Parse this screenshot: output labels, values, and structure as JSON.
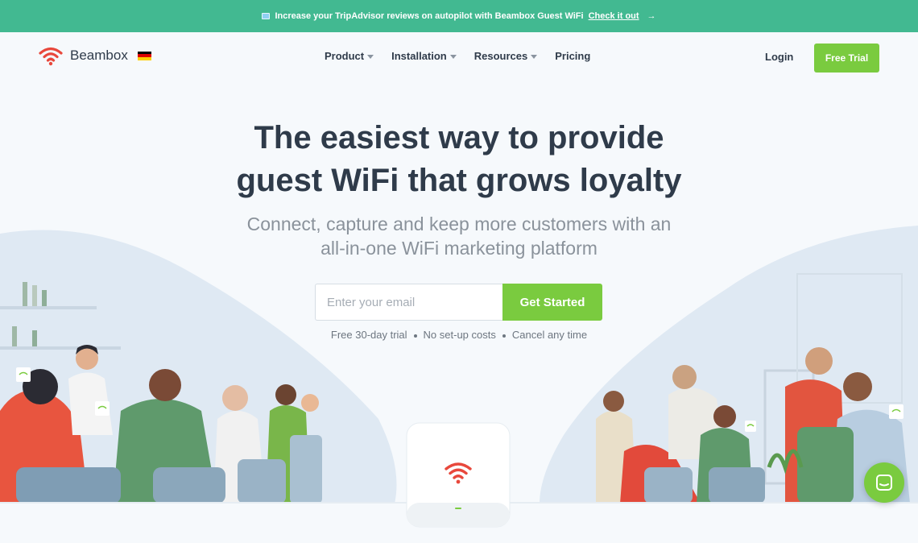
{
  "announcement": {
    "text": "Increase your TripAdvisor reviews on autopilot with Beambox Guest WiFi",
    "link": "Check it out",
    "arrow": "→"
  },
  "nav": {
    "brand": "Beambox",
    "flag_colors": [
      "#000000",
      "#dd0000",
      "#ffce00"
    ],
    "links": [
      "Product",
      "Installation",
      "Resources",
      "Pricing"
    ],
    "login": "Login",
    "free_trial": "Free Trial"
  },
  "hero": {
    "title_line1": "The easiest way to provide",
    "title_line2": "guest WiFi that grows loyalty",
    "subtitle_line1": "Connect, capture and keep more customers with an",
    "subtitle_line2": "all-in-one WiFi marketing platform",
    "email_placeholder": "Enter your email",
    "cta": "Get Started",
    "perks": [
      "Free 30-day trial",
      "No set-up costs",
      "Cancel any time"
    ]
  },
  "colors": {
    "announce_bg": "#42b991",
    "accent_green": "#7acb3f",
    "brand_red": "#e8483c",
    "text_dark": "#2f3b4a"
  },
  "icons": [
    "wifi-logo-icon",
    "germany-flag-icon",
    "chevron-down-icon",
    "chat-icon"
  ]
}
